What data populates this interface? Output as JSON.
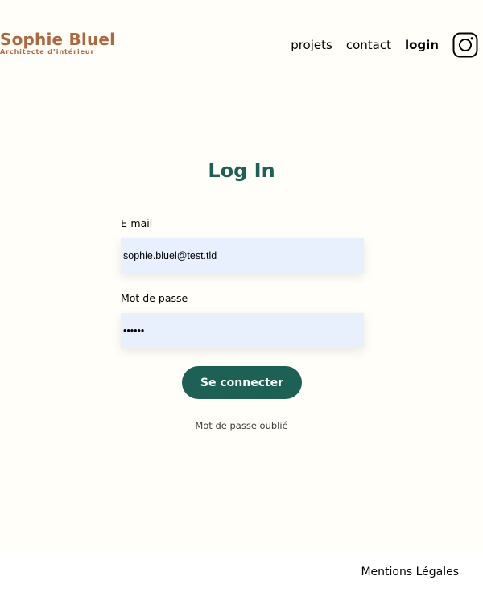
{
  "brand": {
    "name": "Sophie Bluel",
    "subtitle": "Architecte d’intérieur",
    "color": "#b1663c"
  },
  "nav": {
    "items": [
      {
        "label": "projets",
        "active": false
      },
      {
        "label": "contact",
        "active": false
      },
      {
        "label": "login",
        "active": true
      }
    ],
    "social_icon": "instagram-icon"
  },
  "login": {
    "title": "Log In",
    "email_label": "E-mail",
    "email_value": "sophie.bluel@test.tld",
    "password_label": "Mot de passe",
    "password_value": "••••••",
    "submit_label": "Se connecter",
    "forgot_label": "Mot de passe oublié",
    "accent_color": "#1d6154"
  },
  "footer": {
    "legal": "Mentions Légales"
  }
}
